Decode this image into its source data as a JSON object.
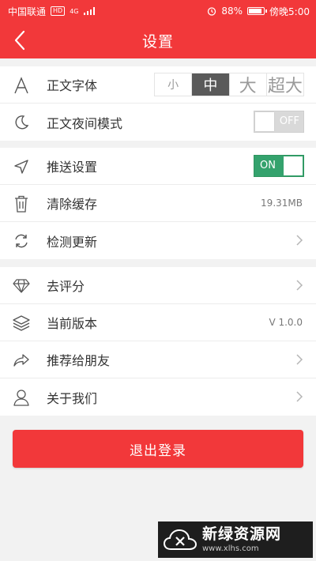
{
  "status_bar": {
    "carrier": "中国联通",
    "badge": "HD",
    "network": "4G",
    "battery": "88%",
    "battery_level": 0.88,
    "time": "傍晚5:00"
  },
  "header": {
    "title": "设置"
  },
  "display": {
    "font_label": "正文字体",
    "font_options": [
      "小",
      "中",
      "大",
      "超大"
    ],
    "font_selected": "中",
    "night_label": "正文夜间模式",
    "night_toggle": "OFF"
  },
  "general": {
    "push_label": "推送设置",
    "push_toggle": "ON",
    "cache_label": "清除缓存",
    "cache_size": "19.31MB",
    "update_label": "检测更新"
  },
  "about": {
    "rate_label": "去评分",
    "version_label": "当前版本",
    "version_value": "V 1.0.0",
    "share_label": "推荐给朋友",
    "about_label": "关于我们"
  },
  "logout_label": "退出登录",
  "watermark": {
    "title": "新绿资源网",
    "url": "www.xlhs.com"
  },
  "colors": {
    "accent": "#f2383a",
    "toggle_on": "#34a26d"
  }
}
